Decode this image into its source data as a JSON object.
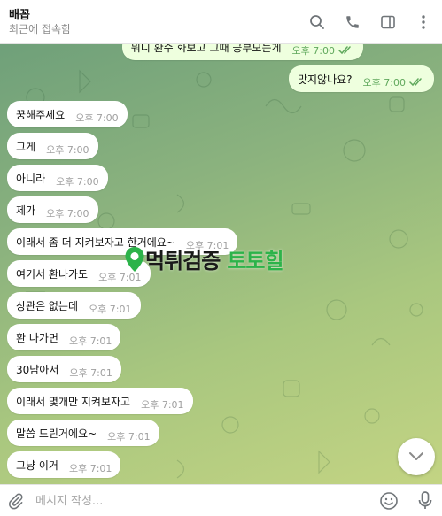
{
  "header": {
    "name": "배꼽",
    "status": "최근에 접속함",
    "icons": [
      "search-icon",
      "phone-icon",
      "sidebar-toggle-icon",
      "more-vert-icon"
    ]
  },
  "messages": [
    {
      "text": "뭐니 환수 화보고 그때 공부모는게",
      "time": "오후 7:00",
      "direction": "out",
      "read": true
    },
    {
      "text": "맞지않나요?",
      "time": "오후 7:00",
      "direction": "out",
      "read": true
    },
    {
      "text": "꿍해주세요",
      "time": "오후 7:00",
      "direction": "in"
    },
    {
      "text": "그게",
      "time": "오후 7:00",
      "direction": "in"
    },
    {
      "text": "아니라",
      "time": "오후 7:00",
      "direction": "in"
    },
    {
      "text": "제가",
      "time": "오후 7:00",
      "direction": "in"
    },
    {
      "text": "이래서 좀 더 지켜보자고 한거에요~",
      "time": "오후 7:01",
      "direction": "in"
    },
    {
      "text": "여기서 환나가도",
      "time": "오후 7:01",
      "direction": "in"
    },
    {
      "text": "상관은 없는데",
      "time": "오후 7:01",
      "direction": "in"
    },
    {
      "text": "환 나가면",
      "time": "오후 7:01",
      "direction": "in"
    },
    {
      "text": "30남아서",
      "time": "오후 7:01",
      "direction": "in"
    },
    {
      "text": "이래서 몇개만 지켜보자고",
      "time": "오후 7:01",
      "direction": "in"
    },
    {
      "text": "말씀 드린거에요~",
      "time": "오후 7:01",
      "direction": "in"
    },
    {
      "text": "그냥 이거",
      "time": "오후 7:01",
      "direction": "in"
    }
  ],
  "watermark": {
    "part1": "먹튀검증",
    "part2": "토토힐",
    "icon": "map-pin-icon"
  },
  "composer": {
    "placeholder": "메시지 작성...",
    "value": ""
  },
  "colors": {
    "incoming": "#ffffff",
    "outgoing": "#eeffde",
    "read_ticks": "#5fa85c",
    "watermark_green": "#2db34a"
  }
}
